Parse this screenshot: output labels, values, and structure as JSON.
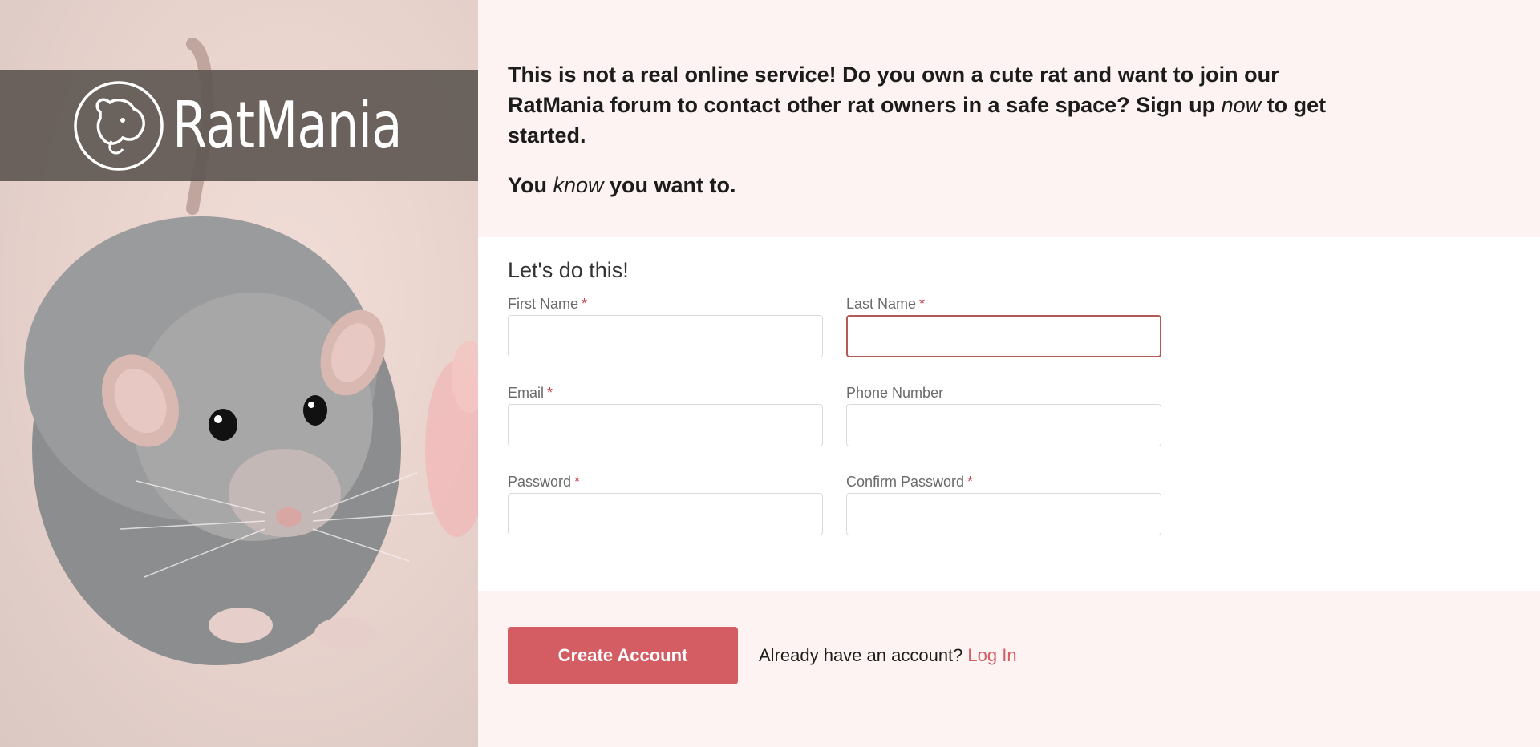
{
  "brand": {
    "name": "RatMania",
    "logo_icon": "rat-head-icon"
  },
  "intro": {
    "line1_a": "This is not a real online service! Do you own a cute rat and want to join our RatMania forum to contact other rat owners in a safe space? Sign up ",
    "line1_em": "now",
    "line1_b": " to get started.",
    "line2_a": "You ",
    "line2_em": "know",
    "line2_b": " you want to."
  },
  "form": {
    "title": "Let's do this!",
    "required_marker": "*",
    "fields": {
      "first_name": {
        "label": "First Name",
        "value": ""
      },
      "last_name": {
        "label": "Last Name",
        "value": ""
      },
      "email": {
        "label": "Email",
        "value": ""
      },
      "phone": {
        "label": "Phone Number",
        "value": ""
      },
      "password": {
        "label": "Password",
        "value": ""
      },
      "confirm_password": {
        "label": "Confirm Password",
        "value": ""
      }
    }
  },
  "actions": {
    "create_account": "Create Account",
    "login_prompt": "Already have an account?",
    "login_link": "Log In"
  },
  "colors": {
    "accent": "#d45d64",
    "page_bg": "#fdf3f2",
    "logo_band": "#605854"
  }
}
